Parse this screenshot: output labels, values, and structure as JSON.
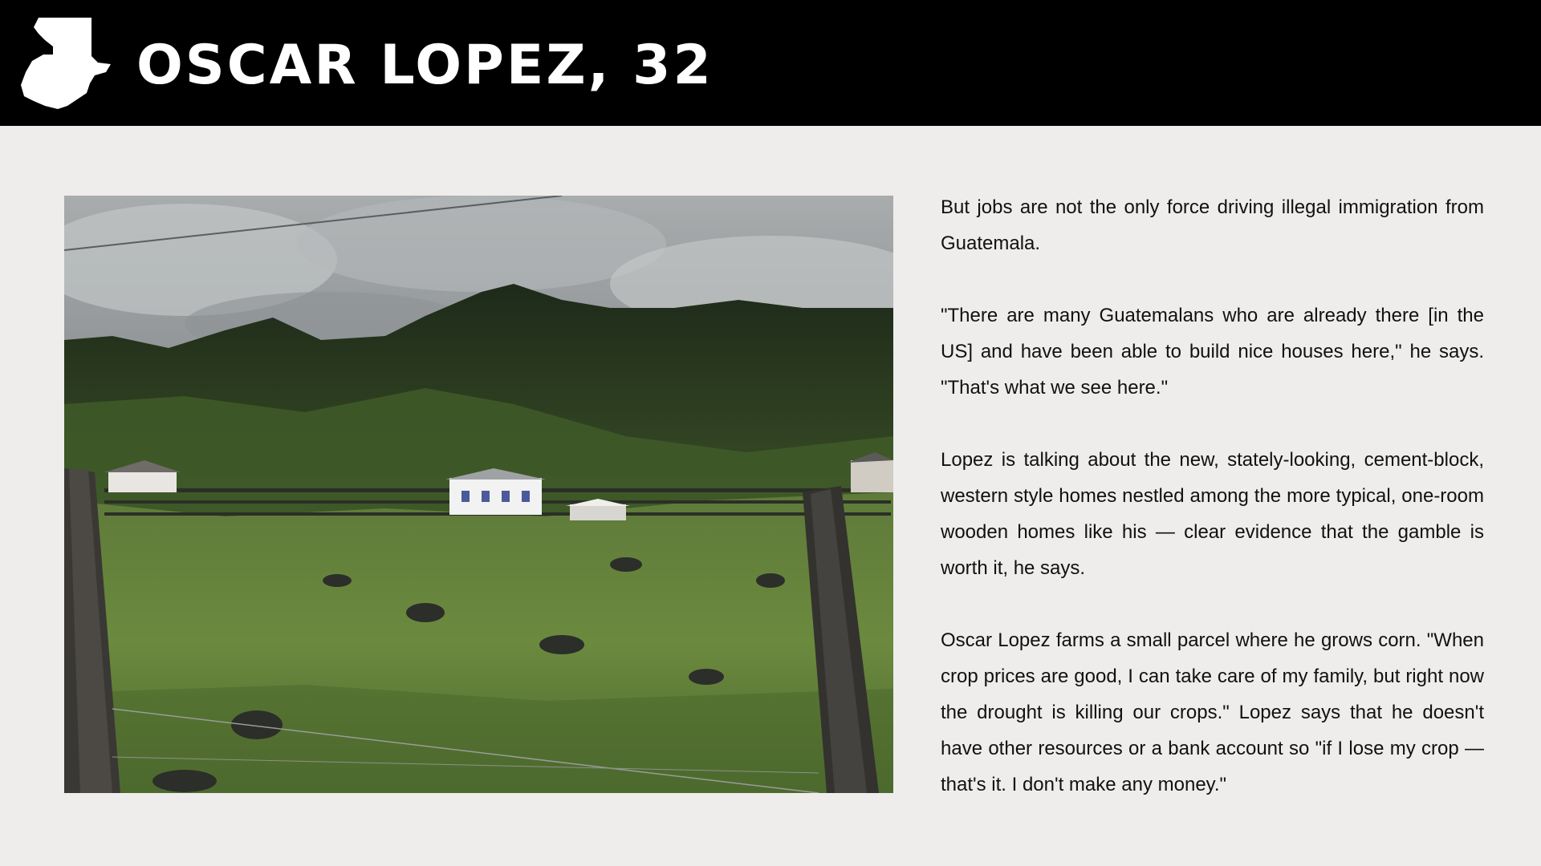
{
  "header": {
    "icon": "guatemala-map-icon",
    "title": "OSCAR LOPEZ, 32"
  },
  "photo": {
    "subject": "green hillside with houses and fence posts"
  },
  "article": {
    "paragraphs": [
      "But jobs are not the only force driving illegal immigration from Guatemala.",
      "\"There are many Guatemalans who are already there [in the US] and have been able to build nice houses here,\" he says. \"That's what we see here.\"",
      "Lopez is talking about the new, stately-looking, cement-block, western style homes nestled among the more typical, one-room wooden homes like his — clear evidence that the gamble is worth it, he says.",
      "Oscar Lopez farms a small parcel where he grows corn. \"When crop prices are good, I can take care of my family, but right now the drought is killing our crops.\" Lopez says that he doesn't have other resources or a bank account so \"if I lose my crop — that's it. I don't make any money.\""
    ]
  },
  "colors": {
    "header_bg": "#000000",
    "page_bg": "#eeedeb",
    "title": "#ffffff",
    "body_text": "#111111"
  }
}
